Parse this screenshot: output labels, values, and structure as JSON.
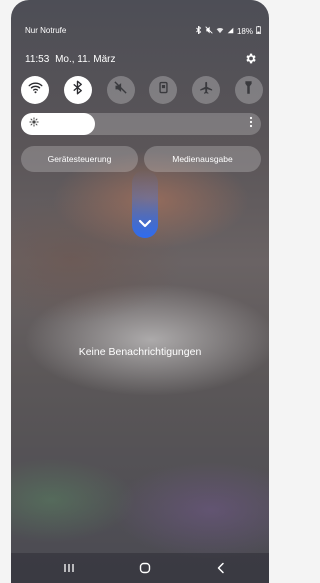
{
  "status_bar": {
    "carrier": "Nur Notrufe",
    "battery": "18%",
    "icons": [
      "bluetooth-icon",
      "mute-icon",
      "wifi-icon",
      "signal-icon",
      "battery-icon"
    ]
  },
  "header": {
    "time": "11:53",
    "date": "Mo., 11. März",
    "settings_icon": "gear-icon"
  },
  "quick_settings": [
    {
      "name": "wifi",
      "icon": "wifi-icon",
      "active": true
    },
    {
      "name": "bluetooth",
      "icon": "bluetooth-icon",
      "active": true
    },
    {
      "name": "sound",
      "icon": "mute-icon",
      "active": false
    },
    {
      "name": "rotation",
      "icon": "rotation-lock-icon",
      "active": false
    },
    {
      "name": "airplane",
      "icon": "airplane-icon",
      "active": false
    },
    {
      "name": "flashlight",
      "icon": "flashlight-icon",
      "active": false
    }
  ],
  "brightness": {
    "level": 0.31,
    "icon": "sun-icon",
    "more_icon": "more-vertical-icon"
  },
  "pills": {
    "device_control": "Gerätesteuerung",
    "media_output": "Medienausgabe"
  },
  "notifications": {
    "empty_message": "Keine Benachrichtigungen"
  },
  "navigation": {
    "recents_icon": "recents-icon",
    "home_icon": "home-icon",
    "back_icon": "back-icon"
  },
  "colors": {
    "accent": "#2f6cf0",
    "active_tile": "#ffffff"
  }
}
